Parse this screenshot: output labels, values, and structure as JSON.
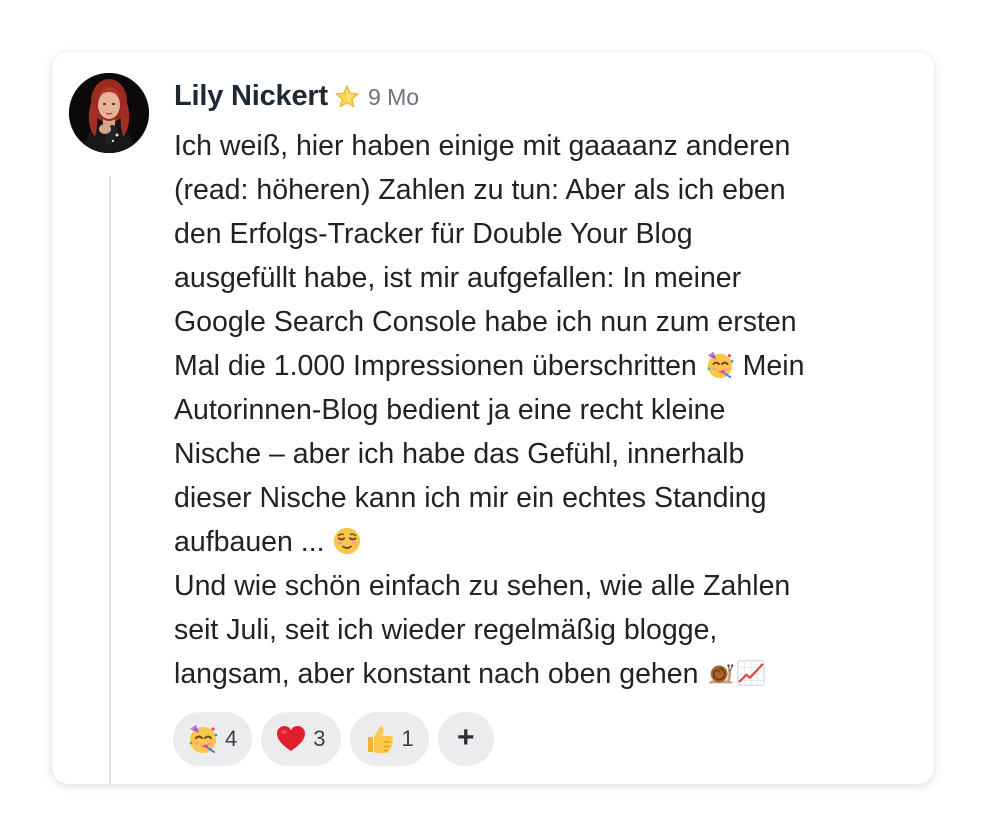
{
  "comment": {
    "author": "Lily Nickert",
    "badge_icon": "star-icon",
    "timestamp": "9 Mo",
    "lines": [
      "Ich weiß, hier haben einige mit gaaaanz anderen",
      "(read: höheren) Zahlen zu tun: Aber als ich eben",
      "den Erfolgs-Tracker für Double Your Blog",
      "ausgefüllt habe, ist mir aufgefallen: In meiner",
      "Google Search Console habe ich nun zum ersten",
      "Mal die 1.000 Impressionen überschritten",
      "Mein",
      "Autorinnen-Blog bedient ja eine recht kleine",
      "Nische – aber ich habe das Gefühl, innerhalb",
      "dieser Nische kann ich mir ein echtes Standing",
      "aufbauen ...",
      "Und wie schön einfach zu sehen, wie alle Zahlen",
      "seit Juli, seit ich wieder regelmäßig blogge,",
      "langsam, aber konstant nach oben gehen"
    ],
    "inline_icons": [
      "partying-face-emoji",
      "relieved-face-emoji",
      "snail-emoji",
      "chart-increasing-emoji"
    ]
  },
  "reactions": [
    {
      "icon": "partying-face-emoji",
      "count": "4"
    },
    {
      "icon": "red-heart-emoji",
      "count": "3"
    },
    {
      "icon": "thumbs-up-emoji",
      "count": "1"
    }
  ],
  "add_reaction_label": "+",
  "colors": {
    "text": "#1f2226",
    "name": "#1f2933",
    "timestamp": "#6b7280",
    "pill_bg": "#ececee",
    "thread_line": "#e4e4e7"
  }
}
